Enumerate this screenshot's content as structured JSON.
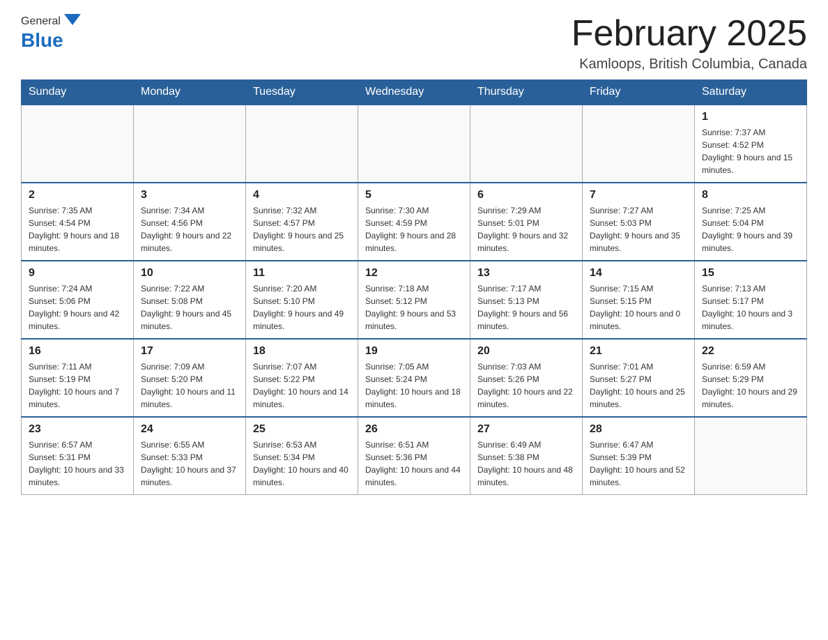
{
  "header": {
    "logo_general": "General",
    "logo_blue": "Blue",
    "title": "February 2025",
    "location": "Kamloops, British Columbia, Canada"
  },
  "days_of_week": [
    "Sunday",
    "Monday",
    "Tuesday",
    "Wednesday",
    "Thursday",
    "Friday",
    "Saturday"
  ],
  "weeks": [
    {
      "days": [
        {
          "number": "",
          "info": ""
        },
        {
          "number": "",
          "info": ""
        },
        {
          "number": "",
          "info": ""
        },
        {
          "number": "",
          "info": ""
        },
        {
          "number": "",
          "info": ""
        },
        {
          "number": "",
          "info": ""
        },
        {
          "number": "1",
          "info": "Sunrise: 7:37 AM\nSunset: 4:52 PM\nDaylight: 9 hours and 15 minutes."
        }
      ]
    },
    {
      "days": [
        {
          "number": "2",
          "info": "Sunrise: 7:35 AM\nSunset: 4:54 PM\nDaylight: 9 hours and 18 minutes."
        },
        {
          "number": "3",
          "info": "Sunrise: 7:34 AM\nSunset: 4:56 PM\nDaylight: 9 hours and 22 minutes."
        },
        {
          "number": "4",
          "info": "Sunrise: 7:32 AM\nSunset: 4:57 PM\nDaylight: 9 hours and 25 minutes."
        },
        {
          "number": "5",
          "info": "Sunrise: 7:30 AM\nSunset: 4:59 PM\nDaylight: 9 hours and 28 minutes."
        },
        {
          "number": "6",
          "info": "Sunrise: 7:29 AM\nSunset: 5:01 PM\nDaylight: 9 hours and 32 minutes."
        },
        {
          "number": "7",
          "info": "Sunrise: 7:27 AM\nSunset: 5:03 PM\nDaylight: 9 hours and 35 minutes."
        },
        {
          "number": "8",
          "info": "Sunrise: 7:25 AM\nSunset: 5:04 PM\nDaylight: 9 hours and 39 minutes."
        }
      ]
    },
    {
      "days": [
        {
          "number": "9",
          "info": "Sunrise: 7:24 AM\nSunset: 5:06 PM\nDaylight: 9 hours and 42 minutes."
        },
        {
          "number": "10",
          "info": "Sunrise: 7:22 AM\nSunset: 5:08 PM\nDaylight: 9 hours and 45 minutes."
        },
        {
          "number": "11",
          "info": "Sunrise: 7:20 AM\nSunset: 5:10 PM\nDaylight: 9 hours and 49 minutes."
        },
        {
          "number": "12",
          "info": "Sunrise: 7:18 AM\nSunset: 5:12 PM\nDaylight: 9 hours and 53 minutes."
        },
        {
          "number": "13",
          "info": "Sunrise: 7:17 AM\nSunset: 5:13 PM\nDaylight: 9 hours and 56 minutes."
        },
        {
          "number": "14",
          "info": "Sunrise: 7:15 AM\nSunset: 5:15 PM\nDaylight: 10 hours and 0 minutes."
        },
        {
          "number": "15",
          "info": "Sunrise: 7:13 AM\nSunset: 5:17 PM\nDaylight: 10 hours and 3 minutes."
        }
      ]
    },
    {
      "days": [
        {
          "number": "16",
          "info": "Sunrise: 7:11 AM\nSunset: 5:19 PM\nDaylight: 10 hours and 7 minutes."
        },
        {
          "number": "17",
          "info": "Sunrise: 7:09 AM\nSunset: 5:20 PM\nDaylight: 10 hours and 11 minutes."
        },
        {
          "number": "18",
          "info": "Sunrise: 7:07 AM\nSunset: 5:22 PM\nDaylight: 10 hours and 14 minutes."
        },
        {
          "number": "19",
          "info": "Sunrise: 7:05 AM\nSunset: 5:24 PM\nDaylight: 10 hours and 18 minutes."
        },
        {
          "number": "20",
          "info": "Sunrise: 7:03 AM\nSunset: 5:26 PM\nDaylight: 10 hours and 22 minutes."
        },
        {
          "number": "21",
          "info": "Sunrise: 7:01 AM\nSunset: 5:27 PM\nDaylight: 10 hours and 25 minutes."
        },
        {
          "number": "22",
          "info": "Sunrise: 6:59 AM\nSunset: 5:29 PM\nDaylight: 10 hours and 29 minutes."
        }
      ]
    },
    {
      "days": [
        {
          "number": "23",
          "info": "Sunrise: 6:57 AM\nSunset: 5:31 PM\nDaylight: 10 hours and 33 minutes."
        },
        {
          "number": "24",
          "info": "Sunrise: 6:55 AM\nSunset: 5:33 PM\nDaylight: 10 hours and 37 minutes."
        },
        {
          "number": "25",
          "info": "Sunrise: 6:53 AM\nSunset: 5:34 PM\nDaylight: 10 hours and 40 minutes."
        },
        {
          "number": "26",
          "info": "Sunrise: 6:51 AM\nSunset: 5:36 PM\nDaylight: 10 hours and 44 minutes."
        },
        {
          "number": "27",
          "info": "Sunrise: 6:49 AM\nSunset: 5:38 PM\nDaylight: 10 hours and 48 minutes."
        },
        {
          "number": "28",
          "info": "Sunrise: 6:47 AM\nSunset: 5:39 PM\nDaylight: 10 hours and 52 minutes."
        },
        {
          "number": "",
          "info": ""
        }
      ]
    }
  ]
}
